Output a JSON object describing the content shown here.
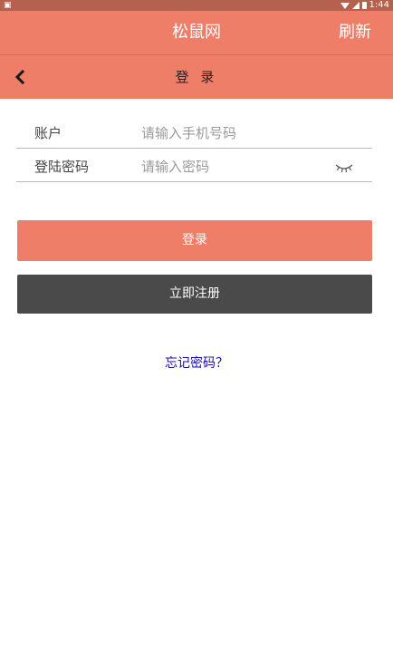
{
  "status_bar": {
    "left_icon": "notification-icon",
    "icons": [
      "wifi-icon",
      "signal-icon",
      "battery-icon"
    ],
    "time": "1:44"
  },
  "app_bar": {
    "title": "松鼠网",
    "refresh_label": "刷新"
  },
  "nav_bar": {
    "back_icon": "chevron-left-icon",
    "title": "登 录"
  },
  "form": {
    "account": {
      "label": "账户",
      "placeholder": "请输入手机号码",
      "value": ""
    },
    "password": {
      "label": "登陆密码",
      "placeholder": "请输入密码",
      "value": "",
      "toggle_icon": "eye-closed-icon"
    }
  },
  "buttons": {
    "login_label": "登录",
    "register_label": "立即注册"
  },
  "links": {
    "forgot_password": "忘记密码？"
  },
  "colors": {
    "accent": "#ef7e68",
    "status_bar": "#b4614e",
    "register_button": "#4a4a4a",
    "link": "#1a0dab"
  }
}
